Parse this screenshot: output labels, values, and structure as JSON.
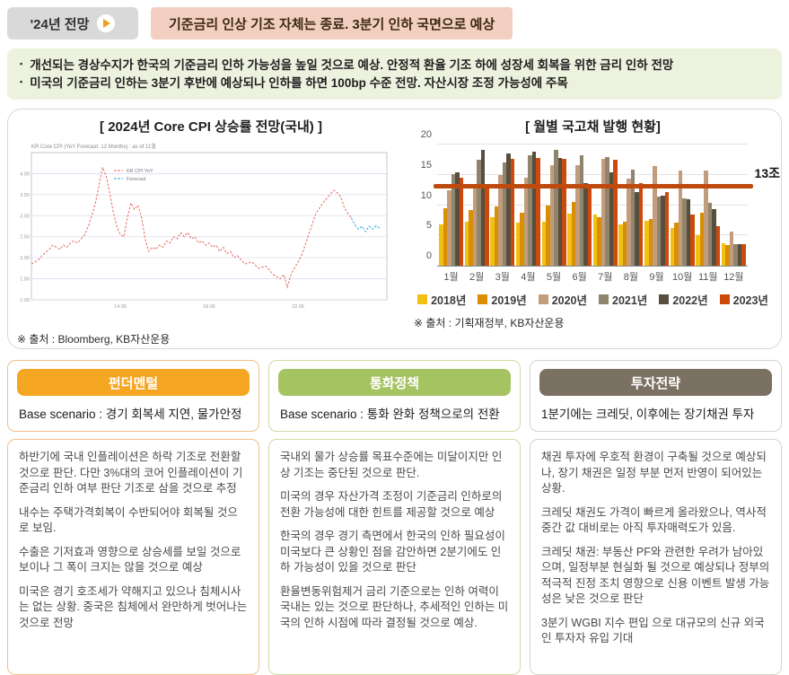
{
  "header": {
    "badge": "'24년 전망",
    "headline": "기준금리 인상 기조 자체는 종료. 3분기 인하 국면으로 예상"
  },
  "summary_bullets": [
    "개선되는 경상수지가 한국의 기준금리 인하 가능성을 높일 것으로 예상. 안정적 환율 기조 하에 성장세 회복을 위한 금리 인하 전망",
    "미국의 기준금리 인하는 3분기 후반에 예상되나 인하를 하면 100bp 수준 전망. 자산시장 조정 가능성에 주목"
  ],
  "chart_data": [
    {
      "type": "line",
      "title": "[ 2024년 Core CPI 상승률 전망(국내) ]",
      "inner_title": "KR Core CPI (YoY Forecast: 12 Months) : as of 11월",
      "source": "※ 출처 : Bloomberg, KB자산운용",
      "ylim": [
        1.0,
        4.5
      ],
      "yticks": [
        1.0,
        1.5,
        2.0,
        2.5,
        3.0,
        3.5,
        4.0
      ],
      "xticks": [
        "14.06",
        "18.06",
        "22.06"
      ],
      "grid": true,
      "legend_position": "inside-top-left",
      "series": [
        {
          "name": "KR CPI YoY",
          "color": "#e8756b",
          "style": "dashed",
          "points": [
            [
              0,
              1.85
            ],
            [
              2,
              1.95
            ],
            [
              3,
              2.05
            ],
            [
              5,
              2.2
            ],
            [
              6,
              2.3
            ],
            [
              7,
              2.25
            ],
            [
              8,
              2.2
            ],
            [
              9,
              2.3
            ],
            [
              10,
              2.25
            ],
            [
              11,
              2.35
            ],
            [
              12,
              2.4
            ],
            [
              13,
              2.35
            ],
            [
              14,
              2.45
            ],
            [
              15,
              2.55
            ],
            [
              16,
              2.75
            ],
            [
              17,
              3.0
            ],
            [
              18,
              3.3
            ],
            [
              19,
              3.7
            ],
            [
              20,
              4.15
            ],
            [
              21,
              3.95
            ],
            [
              22,
              3.55
            ],
            [
              23,
              3.1
            ],
            [
              24,
              2.75
            ],
            [
              25,
              2.55
            ],
            [
              26,
              2.5
            ],
            [
              27,
              2.95
            ],
            [
              28,
              3.3
            ],
            [
              29,
              3.15
            ],
            [
              30,
              3.25
            ],
            [
              31,
              2.95
            ],
            [
              32,
              2.45
            ],
            [
              33,
              2.15
            ],
            [
              34,
              2.25
            ],
            [
              35,
              2.2
            ],
            [
              36,
              2.3
            ],
            [
              37,
              2.25
            ],
            [
              38,
              2.4
            ],
            [
              39,
              2.35
            ],
            [
              40,
              2.5
            ],
            [
              41,
              2.45
            ],
            [
              42,
              2.6
            ],
            [
              43,
              2.5
            ],
            [
              44,
              2.6
            ],
            [
              45,
              2.45
            ],
            [
              46,
              2.5
            ],
            [
              47,
              2.35
            ],
            [
              48,
              2.4
            ],
            [
              49,
              2.3
            ],
            [
              50,
              2.35
            ],
            [
              51,
              2.25
            ],
            [
              52,
              2.3
            ],
            [
              53,
              2.15
            ],
            [
              54,
              2.25
            ],
            [
              55,
              2.1
            ],
            [
              56,
              2.15
            ],
            [
              57,
              2.0
            ],
            [
              58,
              2.05
            ],
            [
              59,
              1.95
            ],
            [
              60,
              1.85
            ],
            [
              62,
              1.9
            ],
            [
              64,
              1.75
            ],
            [
              66,
              1.8
            ],
            [
              68,
              1.6
            ],
            [
              70,
              1.5
            ],
            [
              71,
              1.6
            ],
            [
              72,
              1.3
            ],
            [
              73,
              1.6
            ],
            [
              74,
              1.75
            ],
            [
              76,
              2.05
            ],
            [
              78,
              2.55
            ],
            [
              80,
              3.05
            ],
            [
              82,
              3.3
            ],
            [
              84,
              3.5
            ],
            [
              85,
              3.6
            ],
            [
              86,
              3.55
            ],
            [
              87,
              3.45
            ],
            [
              88,
              3.2
            ],
            [
              89,
              3.05
            ],
            [
              90,
              2.95
            ]
          ]
        },
        {
          "name": "Forecast",
          "color": "#3eb0dc",
          "style": "dashed",
          "points": [
            [
              90,
              2.95
            ],
            [
              91,
              2.78
            ],
            [
              92,
              2.68
            ],
            [
              93,
              2.75
            ],
            [
              94,
              2.62
            ],
            [
              95,
              2.75
            ],
            [
              96,
              2.68
            ],
            [
              97,
              2.76
            ],
            [
              98,
              2.7
            ]
          ]
        }
      ]
    },
    {
      "type": "bar",
      "title": "[ 월별 국고채 발행 현황]",
      "source": "※ 출처 : 기획재정부, KB자산운용",
      "categories": [
        "1월",
        "2월",
        "3월",
        "4월",
        "5월",
        "6월",
        "7월",
        "8월",
        "9월",
        "10월",
        "11월",
        "12월"
      ],
      "ylim": [
        0,
        20
      ],
      "yticks": [
        0,
        5,
        10,
        15,
        20
      ],
      "grid": true,
      "legend_position": "bottom",
      "ref_line": {
        "value": 13,
        "label": "13조",
        "color": "#bf4a0e"
      },
      "series": [
        {
          "name": "2018년",
          "color": "#f2c013",
          "values": [
            6.8,
            7.3,
            8.0,
            7.2,
            7.3,
            8.6,
            8.5,
            6.9,
            7.5,
            6.2,
            5.0,
            3.8
          ]
        },
        {
          "name": "2019년",
          "color": "#d98e04",
          "values": [
            9.5,
            9.2,
            9.8,
            8.7,
            10.0,
            10.5,
            8.0,
            7.3,
            7.7,
            7.1,
            8.7,
            3.5
          ]
        },
        {
          "name": "2020년",
          "color": "#c29d7d",
          "values": [
            12.4,
            12.8,
            15.0,
            14.6,
            16.6,
            16.6,
            17.7,
            14.4,
            16.5,
            15.7,
            15.7,
            5.7
          ]
        },
        {
          "name": "2021년",
          "color": "#90846c",
          "values": [
            15.2,
            17.5,
            17.1,
            18.2,
            19.1,
            18.3,
            17.9,
            15.9,
            11.4,
            11.2,
            10.4,
            3.6
          ]
        },
        {
          "name": "2022년",
          "color": "#564f3f",
          "values": [
            15.4,
            19.2,
            18.5,
            18.9,
            17.8,
            13.6,
            15.5,
            12.1,
            11.6,
            11.0,
            9.4,
            3.6
          ]
        },
        {
          "name": "2023년",
          "color": "#cc4a0b",
          "values": [
            14.6,
            13.2,
            17.7,
            17.8,
            17.7,
            13.0,
            17.5,
            13.6,
            12.2,
            8.5,
            6.5,
            3.6
          ]
        }
      ]
    }
  ],
  "columns": [
    {
      "pill": "펀더멘털",
      "pill_color": "#f5a623",
      "border_color": "#f1c188",
      "scenario": "Base scenario : 경기 회복세 지연, 물가안정",
      "paragraphs": [
        "하반기에 국내 인플레이션은 하락 기조로 전환할 것으로 판단. 다만 3%대의 코어 인플레이션이 기준금리 인하 여부 판단 기조로 삼을 것으로 추정",
        "내수는 주택가격회복이 수반되어야 회복될 것으로 보임.",
        "수출은 기저효과 영향으로 상승세를 보일 것으로 보이나 그 폭이 크지는 않을 것으로 예상",
        "미국은 경기 호조세가 약해지고 있으나 침체시사는 없는 상황. 중국은 침체에서 완만하게 벗어나는 것으로 전망"
      ]
    },
    {
      "pill": "통화정책",
      "pill_color": "#a6c362",
      "border_color": "#cddda2",
      "scenario": "Base scenario : 통화 완화 정책으로의 전환",
      "paragraphs": [
        "국내외 물가 상승률 목표수준에는 미달이지만 인상 기조는 중단된 것으로 판단.",
        "미국의 경우 자산가격 조정이 기준금리 인하로의 전환 가능성에 대한 힌트를 제공할 것으로 예상",
        "한국의 경우 경기 측면에서 한국의 인하 필요성이 미국보다 큰 상황인 점을 감안하면 2분기에도 인하 가능성이 있을 것으로 판단",
        "환율변동위험제거 금리 기준으로는 인하 여력이 국내는 있는 것으로 판단하나, 추세적인 인하는 미국의 인하 시점에 따라 결정될 것으로 예상."
      ]
    },
    {
      "pill": "투자전략",
      "pill_color": "#7b7162",
      "border_color": "#d6d4d0",
      "scenario": "1분기에는 크레딧, 이후에는 장기채권 투자",
      "paragraphs": [
        "채권 투자에 우호적 환경이 구축될 것으로 예상되나, 장기 채권은 일정 부분 먼저 반영이 되어있는 상황.",
        "크레딧 채권도 가격이 빠르게 올라왔으나, 역사적 중간 값 대비로는 아직 투자매력도가 있음.",
        "크레딧 채권: 부동산 PF와 관련한 우려가 남아있으며, 일정부분 현실화 될 것으로 예상되나 정부의 적극적 진정 조치 영향으로 신용 이벤트 발생 가능성은 낮은 것으로 판단",
        "3분기 WGBI 지수 편입 으로 대규모의 신규 외국인 투자자 유입 기대"
      ]
    }
  ]
}
